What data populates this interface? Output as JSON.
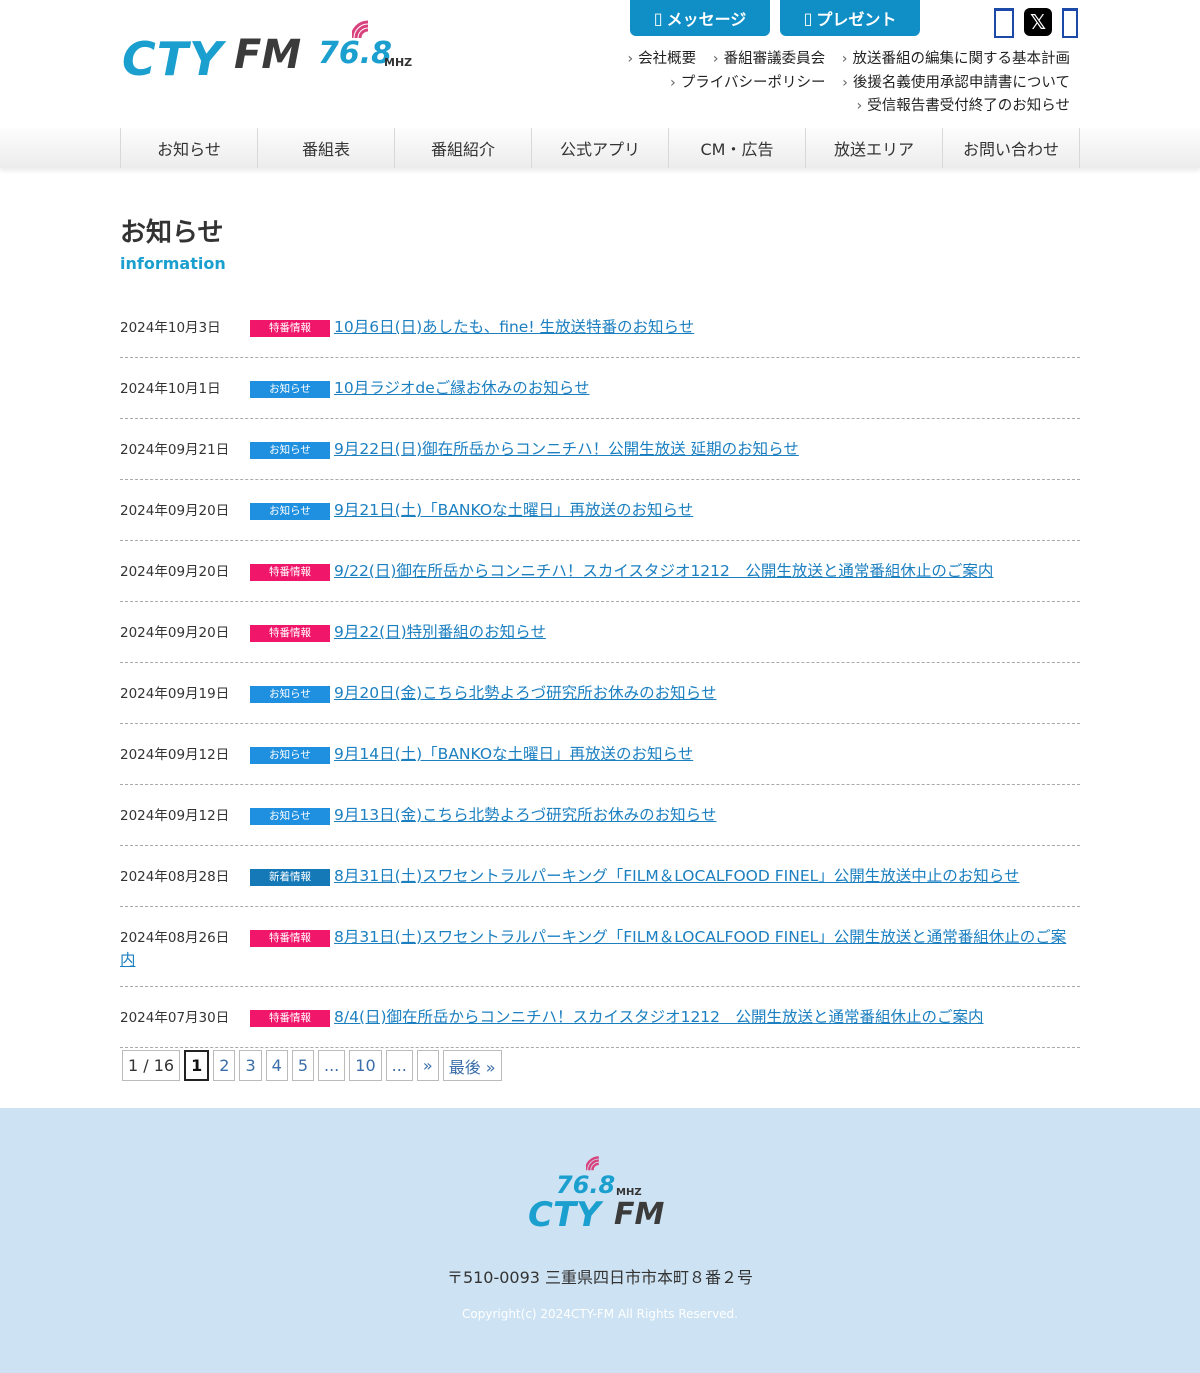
{
  "header": {
    "logo": {
      "brand": "CTY",
      "fm": "FM",
      "frequency": "76.8",
      "unit": "MHZ"
    },
    "buttons": {
      "message": "メッセージ",
      "present": "プレゼント"
    },
    "sns": {
      "facebook_glyph": "",
      "x_glyph": "𝕏",
      "instagram_glyph": ""
    },
    "sublinks": [
      [
        "会社概要",
        "番組審議委員会",
        "放送番組の編集に関する基本計画"
      ],
      [
        "プライバシーポリシー",
        "後援名義使用承認申請書について"
      ],
      [
        "受信報告書受付終了のお知らせ"
      ]
    ]
  },
  "nav": [
    "お知らせ",
    "番組表",
    "番組紹介",
    "公式アプリ",
    "CM・広告",
    "放送エリア",
    "お問い合わせ"
  ],
  "page": {
    "title": "お知らせ",
    "subtitle": "information"
  },
  "colors": {
    "accent": "#1b9fce",
    "badge_special": "#f0166a",
    "badge_notice": "#1f8fe0",
    "badge_new": "#1579b8",
    "footer_bg": "#cde3f3"
  },
  "news": [
    {
      "date": "2024年10月3日",
      "badge": "特番情報",
      "badge_type": "special",
      "title": "10月6日(日)あしたも、fine! 生放送特番のお知らせ"
    },
    {
      "date": "2024年10月1日",
      "badge": "お知らせ",
      "badge_type": "notice",
      "title": "10月ラジオdeご縁お休みのお知らせ"
    },
    {
      "date": "2024年09月21日",
      "badge": "お知らせ",
      "badge_type": "notice",
      "title": "9月22日(日)御在所岳からコンニチハ！公開生放送 延期のお知らせ"
    },
    {
      "date": "2024年09月20日",
      "badge": "お知らせ",
      "badge_type": "notice",
      "title": "9月21日(土)「BANKOな土曜日」再放送のお知らせ"
    },
    {
      "date": "2024年09月20日",
      "badge": "特番情報",
      "badge_type": "special",
      "title": "9/22(日)御在所岳からコンニチハ！スカイスタジオ1212　公開生放送と通常番組休止のご案内"
    },
    {
      "date": "2024年09月20日",
      "badge": "特番情報",
      "badge_type": "special",
      "title": "9月22(日)特別番組のお知らせ"
    },
    {
      "date": "2024年09月19日",
      "badge": "お知らせ",
      "badge_type": "notice",
      "title": "9月20日(金)こちら北勢よろづ研究所お休みのお知らせ"
    },
    {
      "date": "2024年09月12日",
      "badge": "お知らせ",
      "badge_type": "notice",
      "title": "9月14日(土)「BANKOな土曜日」再放送のお知らせ"
    },
    {
      "date": "2024年09月12日",
      "badge": "お知らせ",
      "badge_type": "notice",
      "title": "9月13日(金)こちら北勢よろづ研究所お休みのお知らせ"
    },
    {
      "date": "2024年08月28日",
      "badge": "新着情報",
      "badge_type": "new",
      "title": "8月31日(土)スワセントラルパーキング「FILM＆LOCALFOOD FINEL」公開生放送中止のお知らせ"
    },
    {
      "date": "2024年08月26日",
      "badge": "特番情報",
      "badge_type": "special",
      "title": "8月31日(土)スワセントラルパーキング「FILM＆LOCALFOOD FINEL」公開生放送と通常番組休止のご案内"
    },
    {
      "date": "2024年07月30日",
      "badge": "特番情報",
      "badge_type": "special",
      "title": "8/4(日)御在所岳からコンニチハ！スカイスタジオ1212　公開生放送と通常番組休止のご案内"
    }
  ],
  "pager": {
    "info": "1 / 16",
    "items": [
      {
        "label": "1",
        "current": true
      },
      {
        "label": "2"
      },
      {
        "label": "3"
      },
      {
        "label": "4"
      },
      {
        "label": "5"
      },
      {
        "label": "..."
      },
      {
        "label": "10"
      },
      {
        "label": "..."
      },
      {
        "label": "»"
      },
      {
        "label": "最後 »"
      }
    ]
  },
  "footer": {
    "address": "〒510-0093 三重県四日市市本町８番２号",
    "copyright": "Copyright(c) 2024CTY-FM All Rights Reserved."
  }
}
